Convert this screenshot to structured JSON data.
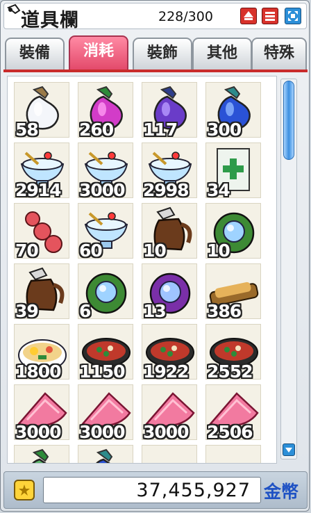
{
  "window": {
    "title": "道具欄",
    "capacity": "228/300",
    "buttons": [
      "add-icon",
      "menu-icon",
      "maximize-icon"
    ]
  },
  "tabs": [
    {
      "label": "裝備",
      "active": false
    },
    {
      "label": "消耗",
      "active": true
    },
    {
      "label": "裝飾",
      "active": false
    },
    {
      "label": "其他",
      "active": false
    },
    {
      "label": "特殊",
      "active": false
    }
  ],
  "items": [
    {
      "icon": "white-potion-icon",
      "qty": "58"
    },
    {
      "icon": "pink-potion-icon",
      "qty": "260"
    },
    {
      "icon": "purple-potion-icon",
      "qty": "117"
    },
    {
      "icon": "blue-potion-icon",
      "qty": "300"
    },
    {
      "icon": "ice-cream-cup-icon",
      "qty": "2914"
    },
    {
      "icon": "ice-cream-cup-icon",
      "qty": "3000"
    },
    {
      "icon": "ice-cream-cup-icon",
      "qty": "2998"
    },
    {
      "icon": "medicine-pack-icon",
      "qty": "34"
    },
    {
      "icon": "red-pill-icon",
      "qty": "70"
    },
    {
      "icon": "ice-cream-glass-icon",
      "qty": "60"
    },
    {
      "icon": "brown-jug-icon",
      "qty": "10"
    },
    {
      "icon": "green-orb-icon",
      "qty": "10"
    },
    {
      "icon": "brown-jug-icon",
      "qty": "39"
    },
    {
      "icon": "green-orb-icon",
      "qty": "6"
    },
    {
      "icon": "purple-orb-icon",
      "qty": "13"
    },
    {
      "icon": "fried-fish-icon",
      "qty": "386"
    },
    {
      "icon": "ramen-bowl-icon",
      "qty": "1800"
    },
    {
      "icon": "pizza-pot-icon",
      "qty": "1150"
    },
    {
      "icon": "pizza-pot-icon",
      "qty": "1922"
    },
    {
      "icon": "pizza-pot-icon",
      "qty": "2552"
    },
    {
      "icon": "meat-slice-icon",
      "qty": "3000"
    },
    {
      "icon": "meat-slice-icon",
      "qty": "3000"
    },
    {
      "icon": "meat-slice-icon",
      "qty": "3000"
    },
    {
      "icon": "meat-slice-icon",
      "qty": "2506"
    },
    {
      "icon": "green-potion-icon",
      "qty": ""
    },
    {
      "icon": "blue-potion-icon",
      "qty": ""
    },
    {
      "icon": "gray-item-icon",
      "qty": ""
    },
    {
      "icon": "gray-item-icon",
      "qty": ""
    }
  ],
  "footer": {
    "currency_icon": "gold-coin-icon",
    "amount": "37,455,927",
    "label": "金幣"
  },
  "colors": {
    "accent_red": "#c92c2c",
    "active_tab": "#e34a6b",
    "scroll_blue": "#2c8fd8"
  }
}
